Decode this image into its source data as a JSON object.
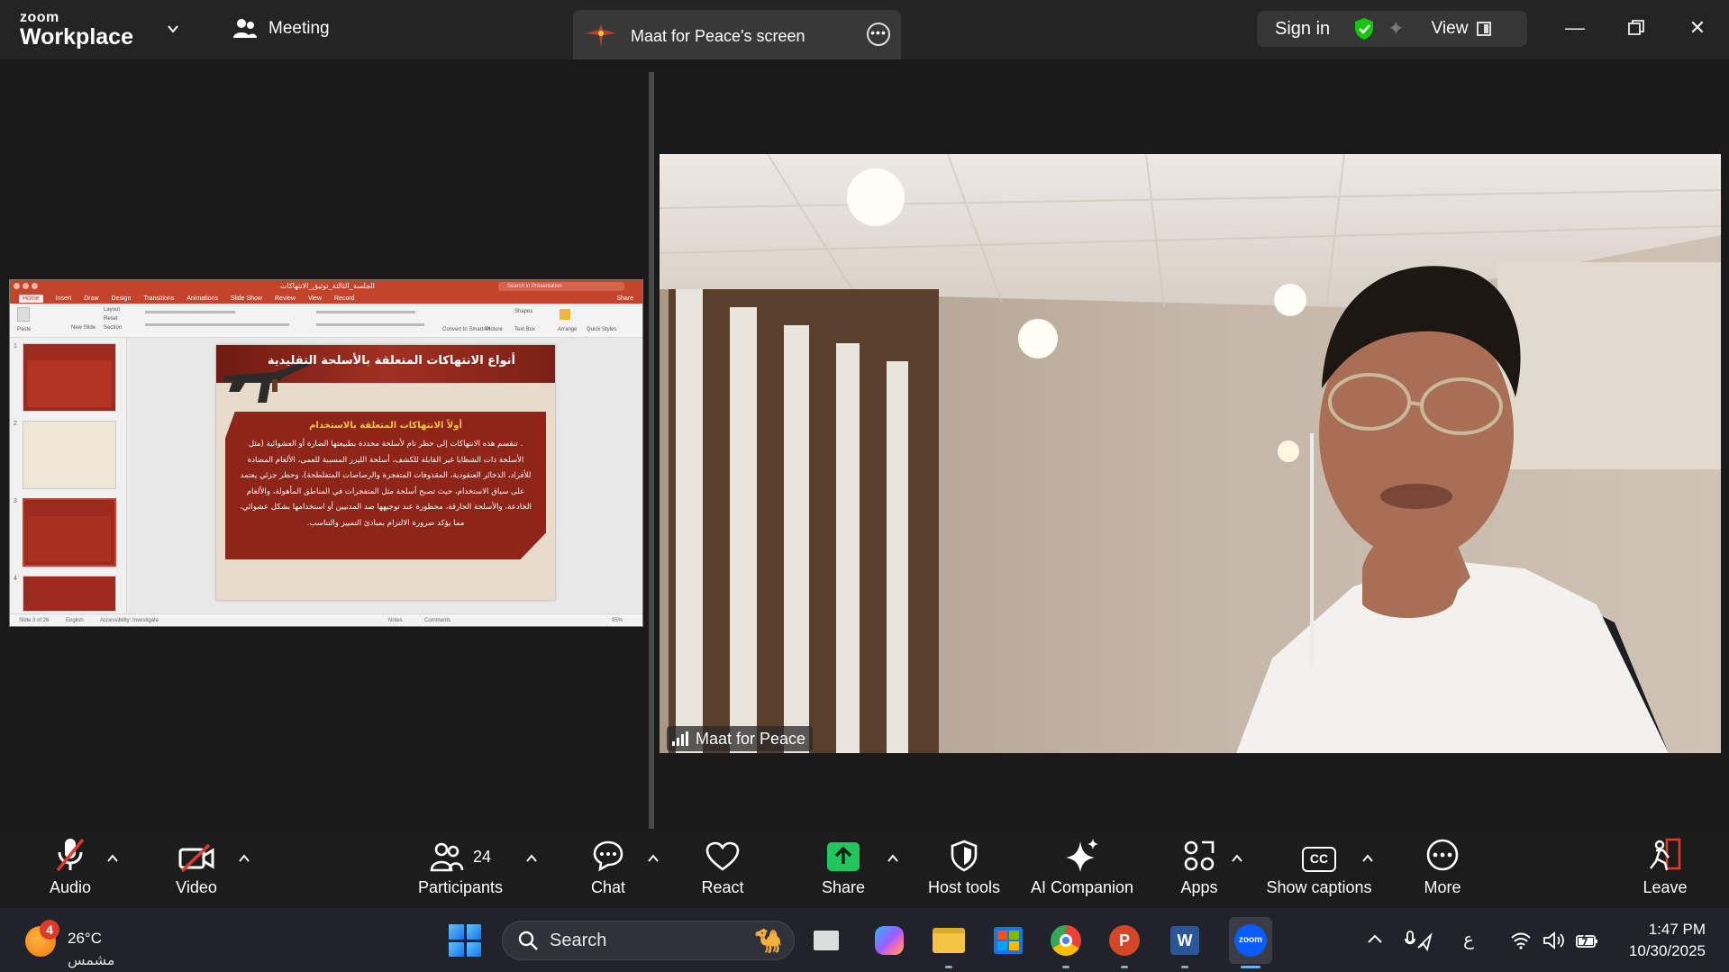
{
  "titlebar": {
    "brand_small": "zoom",
    "brand_large": "Workplace",
    "meeting_label": "Meeting",
    "share_tab_label": "Maat for Peace's screen",
    "sign_in": "Sign in",
    "view": "View"
  },
  "shared_presentation": {
    "doc_name": "الجلسة_الثالثة_توثيق_الانتهاكات",
    "search_placeholder": "Search in Presentation",
    "tabs": [
      "Home",
      "Insert",
      "Draw",
      "Design",
      "Transitions",
      "Animations",
      "Slide Show",
      "Review",
      "View",
      "Record"
    ],
    "share_label": "Share",
    "ribbon_labels": [
      "Paste",
      "Layout",
      "Reset",
      "New Slide",
      "Section",
      "Convert to SmartArt",
      "Picture",
      "Shapes",
      "Text Box",
      "Arrange",
      "Quick Styles"
    ],
    "thumb_numbers": [
      "1",
      "2",
      "3",
      "4"
    ],
    "slide_title": "أنواع الانتهاكات المتعلقة بالأسلحة التقليدية",
    "slide_subtitle": "أولاً الانتهاكات المتعلقة بالاستخدام",
    "slide_body": ". تنقسم هذه الانتهاكات إلى حظر تام لأسلحة محددة بطبيعتها الضارة أو العشوائية (مثل الأسلحة ذات الشظايا غير القابلة للكشف، أسلحة الليزر المسببة للعمى، الألغام المضادة للأفراد، الذخائر العنقودية، المقذوفات المتفجرة والرصاصات المتفلطحة)، وحظر جزئي يعتمد على سياق الاستخدام، حيث تصبح أسلحة مثل المتفجرات في المناطق المأهولة، والألغام الخادعة، والأسلحة الحارقة، محظورة عند توجيهها ضد المدنيين أو استخدامها بشكل عشوائي، مما يؤكد ضرورة الالتزام بمبادئ التمييز والتناسب.",
    "status_slide": "Slide 3 of 26",
    "status_lang": "English",
    "status_access": "Accessibility: Investigate",
    "status_notes": "Notes",
    "status_comments": "Comments",
    "status_zoom": "95%"
  },
  "video": {
    "participant_name": "Maat for Peace"
  },
  "controls": {
    "audio": "Audio",
    "video": "Video",
    "participants": "Participants",
    "participants_count": "24",
    "chat": "Chat",
    "react": "React",
    "share": "Share",
    "host_tools": "Host tools",
    "ai_companion": "AI Companion",
    "apps": "Apps",
    "show_captions": "Show captions",
    "captions_icon_text": "CC",
    "more": "More",
    "leave": "Leave"
  },
  "taskbar": {
    "weather_alert_count": "4",
    "temperature": "26°C",
    "weather_condition": "مشمس",
    "search_label": "Search",
    "zoom_app_text": "zoom",
    "powerpoint_letter": "P",
    "word_letter": "W",
    "input_lang": "ع",
    "time": "1:47 PM",
    "date": "10/30/2025"
  },
  "colors": {
    "accent_green": "#16c60c",
    "share_green": "#22c55e",
    "mute_red": "#e0392b",
    "leave_red": "#e0392b",
    "ppt_red": "#c4442b",
    "zoom_blue": "#0b5cff"
  },
  "icons": {
    "meeting": "people-icon",
    "security": "shield-check-icon",
    "ai": "sparkle-icon",
    "audio": "microphone-muted-icon",
    "video": "camera-off-icon"
  }
}
